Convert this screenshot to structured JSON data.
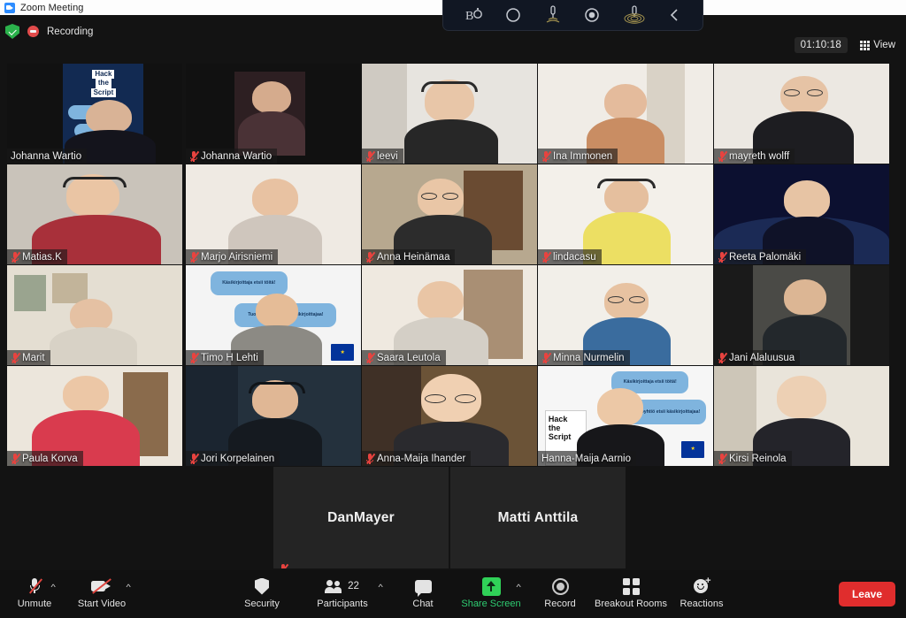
{
  "window": {
    "title": "Zoom Meeting",
    "app_icon": "zoom-icon"
  },
  "os_overlay": {
    "icons": [
      "bo-logo-icon",
      "circle-icon",
      "microphone-wave-icon",
      "record-dot-icon",
      "microphone-ripple-icon",
      "chevron-left-icon"
    ]
  },
  "topbar": {
    "encryption_icon": "green-shield-check-icon",
    "recording_icon": "recording-dot-icon",
    "recording_label": "Recording",
    "timer": "01:10:18",
    "view_label": "View",
    "view_icon": "grid-icon"
  },
  "gallery": {
    "active_speaker": "Johanna Wartio",
    "participants": [
      {
        "name": "Johanna Wartio",
        "muted": false,
        "active": true,
        "video": true,
        "scene": "banner-johanna"
      },
      {
        "name": "Johanna Wartio",
        "muted": true,
        "active": false,
        "video": true,
        "scene": "photo-dark"
      },
      {
        "name": "leevi",
        "muted": true,
        "active": false,
        "video": true,
        "scene": "headset-room"
      },
      {
        "name": "Ina Immonen",
        "muted": true,
        "active": false,
        "video": true,
        "scene": "bright-room"
      },
      {
        "name": "mayreth wolff",
        "muted": true,
        "active": false,
        "video": true,
        "scene": "glasses-room"
      },
      {
        "name": "Matias.K",
        "muted": true,
        "active": false,
        "video": true,
        "scene": "beard-headset"
      },
      {
        "name": "Marjo Airisniemi",
        "muted": true,
        "active": false,
        "video": true,
        "scene": "light-room"
      },
      {
        "name": "Anna Heinämaa",
        "muted": true,
        "active": false,
        "video": true,
        "scene": "bookshelf"
      },
      {
        "name": "lindacasu",
        "muted": true,
        "active": false,
        "video": true,
        "scene": "yellow-shirt"
      },
      {
        "name": "Reeta Palomäki",
        "muted": true,
        "active": false,
        "video": true,
        "scene": "space-bg"
      },
      {
        "name": "Marit",
        "muted": true,
        "active": false,
        "video": true,
        "scene": "art-wall"
      },
      {
        "name": "Timo H Lehti",
        "muted": true,
        "active": false,
        "video": true,
        "scene": "bubbles-timo"
      },
      {
        "name": "Saara Leutola",
        "muted": true,
        "active": false,
        "video": true,
        "scene": "shelf-room"
      },
      {
        "name": "Minna Nurmelin",
        "muted": true,
        "active": false,
        "video": true,
        "scene": "plain-room"
      },
      {
        "name": "Jani Alaluusua",
        "muted": true,
        "active": false,
        "video": true,
        "scene": "dark-room"
      },
      {
        "name": "Paula Korva",
        "muted": true,
        "active": false,
        "video": true,
        "scene": "red-shirt"
      },
      {
        "name": "Jori Korpelainen",
        "muted": true,
        "active": false,
        "video": true,
        "scene": "headphones-dark"
      },
      {
        "name": "Anna-Maija Ihander",
        "muted": true,
        "active": false,
        "video": true,
        "scene": "bookshelf-glasses"
      },
      {
        "name": "Hanna-Maija Aarnio",
        "muted": false,
        "active": false,
        "video": true,
        "scene": "bubbles-hanna"
      },
      {
        "name": "Kirsi Reinola",
        "muted": true,
        "active": false,
        "video": true,
        "scene": "window-light"
      },
      {
        "name": "DanMayer",
        "muted": true,
        "active": false,
        "video": false,
        "scene": ""
      },
      {
        "name": "Matti Anttila",
        "muted": false,
        "active": false,
        "video": false,
        "scene": ""
      }
    ],
    "virtual_background": {
      "banner_lines": [
        "Hack",
        "the",
        "Script"
      ],
      "bubble_1": "Käsikirjoittaja etsii töitä!",
      "bubble_2": "Tuotantoyhtiö etsii käsikirjoittajaa!",
      "flag": "eu-flag-icon"
    }
  },
  "toolbar": {
    "mute_label": "Unmute",
    "mute_icon": "microphone-muted-icon",
    "video_label": "Start Video",
    "video_icon": "camera-off-icon",
    "security_label": "Security",
    "security_icon": "shield-icon",
    "participants_label": "Participants",
    "participants_icon": "people-icon",
    "participants_count": "22",
    "chat_label": "Chat",
    "chat_icon": "chat-bubble-icon",
    "share_label": "Share Screen",
    "share_icon": "share-screen-icon",
    "record_label": "Record",
    "record_icon": "record-circle-icon",
    "rooms_label": "Breakout Rooms",
    "rooms_icon": "breakout-rooms-icon",
    "reactions_label": "Reactions",
    "reactions_icon": "smiley-plus-icon",
    "leave_label": "Leave",
    "caret_icon": "chevron-up-icon"
  },
  "colors": {
    "active_border": "#b8e034",
    "leave_red": "#e02d2d",
    "share_green": "#2ecc71",
    "mute_red": "#e8433f",
    "bg": "#131313"
  }
}
